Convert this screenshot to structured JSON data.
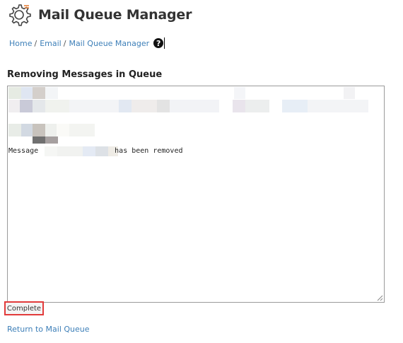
{
  "header": {
    "title": "Mail Queue Manager",
    "icon": "gear-icon"
  },
  "breadcrumb": {
    "items": [
      {
        "label": "Home"
      },
      {
        "label": "Email"
      },
      {
        "label": "Mail Queue Manager"
      }
    ],
    "separator": "/",
    "help_icon": "question-circle-icon"
  },
  "section": {
    "title": "Removing Messages in Queue"
  },
  "output": {
    "message_prefix": "Message",
    "message_suffix": "has been removed"
  },
  "status": {
    "label": "Complete",
    "highlight_color": "#e23b3b"
  },
  "footer": {
    "return_link": "Return to Mail Queue"
  },
  "colors": {
    "link": "#3d7fb8",
    "accent": "#e8823b"
  }
}
